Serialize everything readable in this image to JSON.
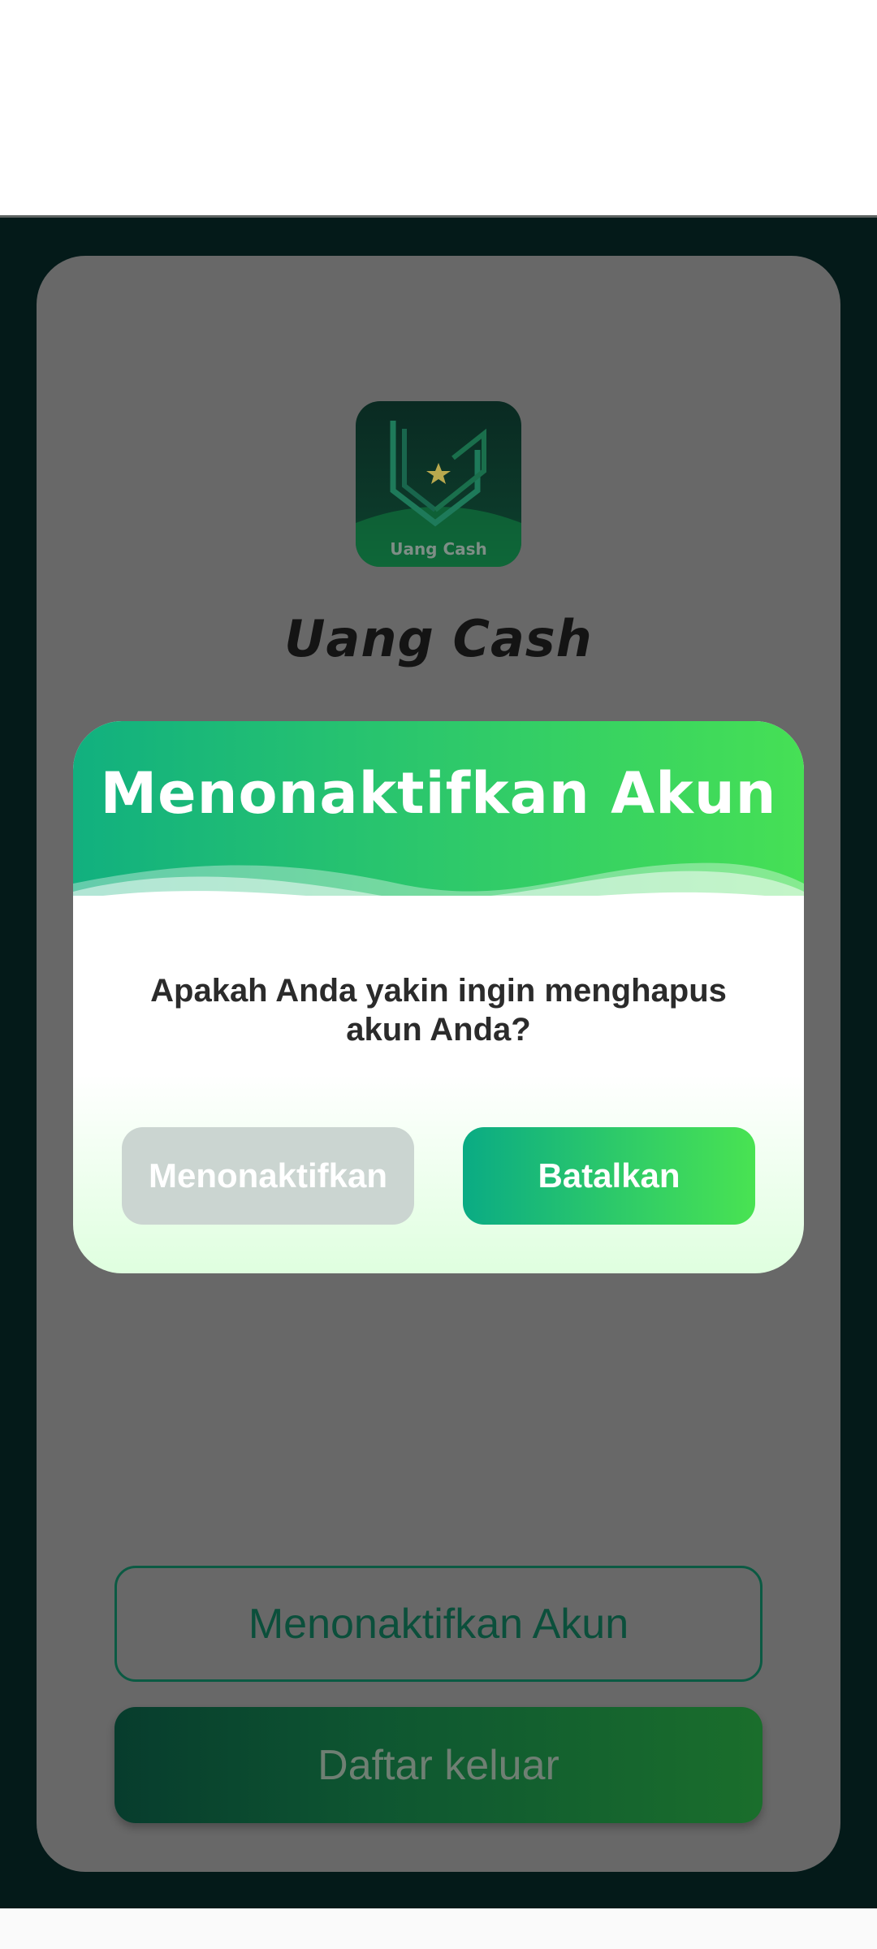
{
  "app": {
    "name": "Uang Cash",
    "logo_text": "Uang Cash",
    "logo_icon": "shield-star-icon"
  },
  "background_buttons": {
    "deactivate_account": "Menonaktifkan Akun",
    "logout": "Daftar keluar"
  },
  "dialog": {
    "title": "Menonaktifkan Akun",
    "message": "Apakah Anda yakin ingin menghapus akun Anda?",
    "confirm_label": "Menonaktifkan",
    "cancel_label": "Batalkan"
  },
  "colors": {
    "brand_green": "#2dc86b",
    "dark_background": "#041a19",
    "overlay_gray": "#686868",
    "disabled_button": "#cbd5d1"
  }
}
